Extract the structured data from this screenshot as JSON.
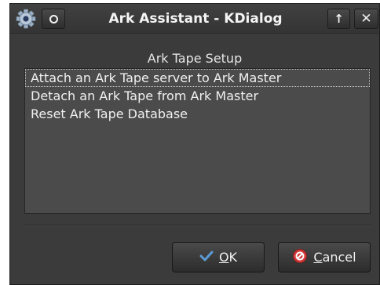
{
  "window": {
    "title": "Ark Assistant - KDialog"
  },
  "icons": {
    "app": "gear-icon",
    "menu": "window-menu-icon",
    "keep_above": "arrow-up-icon",
    "close": "close-icon",
    "ok": "checkmark-icon",
    "cancel": "cancel-icon"
  },
  "titlebar_buttons": {
    "keep_above_glyph": "↑",
    "close_glyph": "✕"
  },
  "dialog": {
    "label": "Ark Tape Setup",
    "items": [
      {
        "label": "Attach an Ark Tape server to Ark Master",
        "focused": true
      },
      {
        "label": "Detach an Ark Tape from Ark Master",
        "focused": false
      },
      {
        "label": "Reset Ark Tape Database",
        "focused": false
      }
    ]
  },
  "buttons": {
    "ok": {
      "mnemonic": "O",
      "rest": "K"
    },
    "cancel": {
      "mnemonic": "C",
      "rest": "ancel"
    }
  },
  "colors": {
    "window_bg": "#3b3b3b",
    "list_bg": "#4b4b4b",
    "text": "#f0f0f0",
    "ok_icon": "#5b9bd5",
    "cancel_icon": "#d43b3b"
  }
}
